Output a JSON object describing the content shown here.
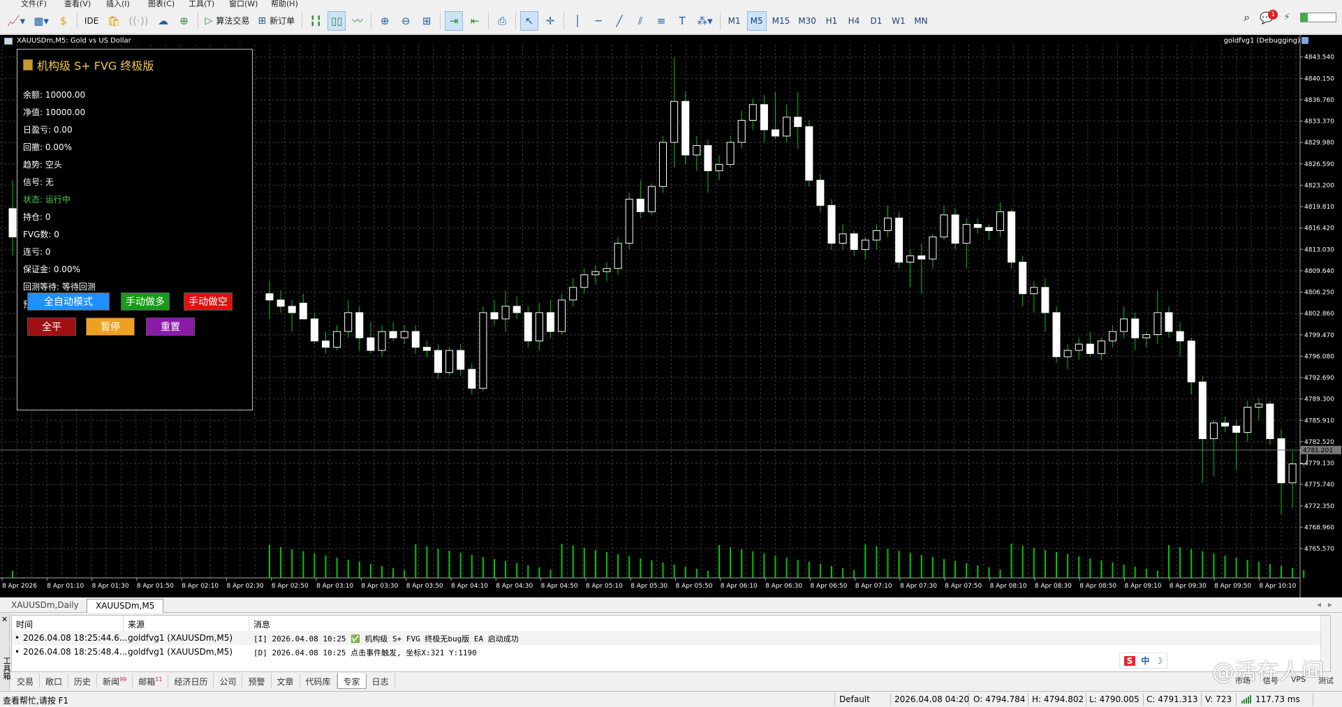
{
  "menu": [
    "文件(F)",
    "查看(V)",
    "插入(I)",
    "图表(C)",
    "工具(T)",
    "窗口(W)",
    "帮助(H)"
  ],
  "toolbar": {
    "ide_label": "IDE",
    "algo_label": "算法交易",
    "new_order_label": "新订单",
    "timeframes": [
      "M1",
      "M5",
      "M15",
      "M30",
      "H1",
      "H4",
      "D1",
      "W1",
      "MN"
    ],
    "active_timeframe": "M5",
    "notification_count": "1"
  },
  "chart": {
    "title": "XAUUSDm,M5:  Gold vs US Dollar",
    "ea_label": "goldfvg1 (Debugging)",
    "current_price_tag": "4781.201",
    "price_ticks": [
      "4843.540",
      "4840.150",
      "4836.760",
      "4833.370",
      "4829.980",
      "4826.590",
      "4823.200",
      "4819.810",
      "4816.420",
      "4813.030",
      "4809.640",
      "4806.250",
      "4802.860",
      "4799.470",
      "4796.080",
      "4792.690",
      "4789.300",
      "4785.910",
      "4782.520",
      "4779.130",
      "4775.740",
      "4772.350",
      "4768.960",
      "4765.570"
    ],
    "time_ticks": [
      "8 Apr 2026",
      "8 Apr 01:10",
      "8 Apr 01:30",
      "8 Apr 01:50",
      "8 Apr 02:10",
      "8 Apr 02:30",
      "8 Apr 02:50",
      "8 Apr 03:10",
      "8 Apr 03:30",
      "8 Apr 03:50",
      "8 Apr 04:10",
      "8 Apr 04:30",
      "8 Apr 04:50",
      "8 Apr 05:10",
      "8 Apr 05:30",
      "8 Apr 05:50",
      "8 Apr 06:10",
      "8 Apr 06:30",
      "8 Apr 06:50",
      "8 Apr 07:10",
      "8 Apr 07:30",
      "8 Apr 07:50",
      "8 Apr 08:10",
      "8 Apr 08:30",
      "8 Apr 08:50",
      "8 Apr 09:10",
      "8 Apr 09:30",
      "8 Apr 09:50",
      "8 Apr 10:10"
    ],
    "colors": {
      "background": "#000000",
      "grid": "#3a3a3a",
      "bull": "#ffffff",
      "bear": "#ffffff",
      "wick": "#00c800",
      "volume": "#00c800"
    }
  },
  "chart_data": {
    "type": "candlestick",
    "symbol": "XAUUSDm",
    "timeframe": "M5",
    "ylim": [
      4763.8,
      4845.5
    ],
    "current_price": 4781.201,
    "candles": [
      {
        "o": 4819.5,
        "h": 4824.0,
        "l": 4812.0,
        "c": 4815.0
      },
      {
        "o": 4806.0,
        "h": 4808.0,
        "l": 4802.0,
        "c": 4805.0
      },
      {
        "o": 4805.0,
        "h": 4806.5,
        "l": 4803.0,
        "c": 4804.0
      },
      {
        "o": 4804.0,
        "h": 4805.0,
        "l": 4800.0,
        "c": 4803.0
      },
      {
        "o": 4804.5,
        "h": 4806.0,
        "l": 4802.0,
        "c": 4802.0
      },
      {
        "o": 4802.0,
        "h": 4803.0,
        "l": 4798.0,
        "c": 4798.5
      },
      {
        "o": 4798.5,
        "h": 4800.0,
        "l": 4796.5,
        "c": 4797.5
      },
      {
        "o": 4797.5,
        "h": 4801.0,
        "l": 4797.0,
        "c": 4800.0
      },
      {
        "o": 4800.0,
        "h": 4805.0,
        "l": 4799.0,
        "c": 4803.0
      },
      {
        "o": 4803.0,
        "h": 4804.0,
        "l": 4797.0,
        "c": 4799.0
      },
      {
        "o": 4799.0,
        "h": 4801.5,
        "l": 4796.5,
        "c": 4797.0
      },
      {
        "o": 4797.0,
        "h": 4801.0,
        "l": 4796.0,
        "c": 4800.0
      },
      {
        "o": 4800.0,
        "h": 4801.5,
        "l": 4798.5,
        "c": 4799.0
      },
      {
        "o": 4799.0,
        "h": 4801.0,
        "l": 4798.0,
        "c": 4800.0
      },
      {
        "o": 4800.0,
        "h": 4801.0,
        "l": 4796.5,
        "c": 4797.5
      },
      {
        "o": 4797.5,
        "h": 4798.5,
        "l": 4796.0,
        "c": 4797.0
      },
      {
        "o": 4797.0,
        "h": 4798.0,
        "l": 4792.5,
        "c": 4793.5
      },
      {
        "o": 4793.5,
        "h": 4797.5,
        "l": 4793.0,
        "c": 4797.0
      },
      {
        "o": 4797.0,
        "h": 4798.0,
        "l": 4793.0,
        "c": 4794.0
      },
      {
        "o": 4794.0,
        "h": 4795.0,
        "l": 4790.0,
        "c": 4791.0
      },
      {
        "o": 4791.0,
        "h": 4804.0,
        "l": 4790.5,
        "c": 4803.0
      },
      {
        "o": 4803.0,
        "h": 4805.0,
        "l": 4801.0,
        "c": 4802.0
      },
      {
        "o": 4802.0,
        "h": 4806.5,
        "l": 4800.0,
        "c": 4804.0
      },
      {
        "o": 4804.0,
        "h": 4805.5,
        "l": 4802.0,
        "c": 4803.0
      },
      {
        "o": 4803.0,
        "h": 4804.0,
        "l": 4797.5,
        "c": 4798.5
      },
      {
        "o": 4798.5,
        "h": 4804.5,
        "l": 4797.0,
        "c": 4803.0
      },
      {
        "o": 4803.0,
        "h": 4805.0,
        "l": 4799.0,
        "c": 4800.0
      },
      {
        "o": 4800.0,
        "h": 4806.0,
        "l": 4799.5,
        "c": 4805.0
      },
      {
        "o": 4805.0,
        "h": 4808.5,
        "l": 4804.0,
        "c": 4807.0
      },
      {
        "o": 4807.0,
        "h": 4810.0,
        "l": 4806.0,
        "c": 4809.0
      },
      {
        "o": 4809.0,
        "h": 4810.5,
        "l": 4807.5,
        "c": 4809.5
      },
      {
        "o": 4809.5,
        "h": 4811.0,
        "l": 4808.0,
        "c": 4810.0
      },
      {
        "o": 4810.0,
        "h": 4815.0,
        "l": 4809.0,
        "c": 4814.0
      },
      {
        "o": 4814.0,
        "h": 4822.0,
        "l": 4813.0,
        "c": 4821.0
      },
      {
        "o": 4821.0,
        "h": 4824.0,
        "l": 4818.0,
        "c": 4819.0
      },
      {
        "o": 4819.0,
        "h": 4823.5,
        "l": 4818.5,
        "c": 4823.0
      },
      {
        "o": 4823.0,
        "h": 4831.0,
        "l": 4822.0,
        "c": 4830.0
      },
      {
        "o": 4830.0,
        "h": 4843.5,
        "l": 4826.0,
        "c": 4836.5
      },
      {
        "o": 4836.5,
        "h": 4838.0,
        "l": 4826.5,
        "c": 4828.0
      },
      {
        "o": 4828.0,
        "h": 4831.0,
        "l": 4825.5,
        "c": 4829.5
      },
      {
        "o": 4829.5,
        "h": 4830.5,
        "l": 4822.0,
        "c": 4825.5
      },
      {
        "o": 4825.5,
        "h": 4828.0,
        "l": 4824.0,
        "c": 4826.5
      },
      {
        "o": 4826.5,
        "h": 4831.0,
        "l": 4826.0,
        "c": 4830.0
      },
      {
        "o": 4830.0,
        "h": 4835.0,
        "l": 4829.0,
        "c": 4833.5
      },
      {
        "o": 4833.5,
        "h": 4837.0,
        "l": 4832.0,
        "c": 4836.0
      },
      {
        "o": 4836.0,
        "h": 4837.5,
        "l": 4830.0,
        "c": 4832.0
      },
      {
        "o": 4832.0,
        "h": 4838.0,
        "l": 4830.5,
        "c": 4831.0
      },
      {
        "o": 4831.0,
        "h": 4836.0,
        "l": 4830.0,
        "c": 4834.0
      },
      {
        "o": 4834.0,
        "h": 4838.0,
        "l": 4829.0,
        "c": 4832.5
      },
      {
        "o": 4832.5,
        "h": 4833.5,
        "l": 4823.0,
        "c": 4824.0
      },
      {
        "o": 4824.0,
        "h": 4825.0,
        "l": 4819.0,
        "c": 4820.0
      },
      {
        "o": 4820.0,
        "h": 4821.0,
        "l": 4813.0,
        "c": 4814.0
      },
      {
        "o": 4814.0,
        "h": 4817.0,
        "l": 4813.0,
        "c": 4815.5
      },
      {
        "o": 4815.5,
        "h": 4816.0,
        "l": 4812.0,
        "c": 4813.0
      },
      {
        "o": 4813.0,
        "h": 4815.0,
        "l": 4811.5,
        "c": 4814.5
      },
      {
        "o": 4814.5,
        "h": 4817.0,
        "l": 4813.0,
        "c": 4816.0
      },
      {
        "o": 4816.0,
        "h": 4820.0,
        "l": 4815.0,
        "c": 4818.0
      },
      {
        "o": 4818.0,
        "h": 4819.0,
        "l": 4810.0,
        "c": 4811.0
      },
      {
        "o": 4811.0,
        "h": 4813.0,
        "l": 4807.0,
        "c": 4812.0
      },
      {
        "o": 4812.0,
        "h": 4814.0,
        "l": 4806.0,
        "c": 4811.5
      },
      {
        "o": 4811.5,
        "h": 4815.5,
        "l": 4810.0,
        "c": 4815.0
      },
      {
        "o": 4815.0,
        "h": 4820.0,
        "l": 4814.5,
        "c": 4818.5
      },
      {
        "o": 4818.5,
        "h": 4819.5,
        "l": 4813.0,
        "c": 4814.0
      },
      {
        "o": 4814.0,
        "h": 4818.0,
        "l": 4810.0,
        "c": 4817.0
      },
      {
        "o": 4817.0,
        "h": 4818.0,
        "l": 4815.5,
        "c": 4816.5
      },
      {
        "o": 4816.5,
        "h": 4817.0,
        "l": 4814.5,
        "c": 4816.0
      },
      {
        "o": 4816.0,
        "h": 4820.5,
        "l": 4815.0,
        "c": 4819.0
      },
      {
        "o": 4819.0,
        "h": 4819.5,
        "l": 4810.0,
        "c": 4811.0
      },
      {
        "o": 4811.0,
        "h": 4812.0,
        "l": 4804.0,
        "c": 4806.0
      },
      {
        "o": 4806.0,
        "h": 4808.0,
        "l": 4803.0,
        "c": 4807.0
      },
      {
        "o": 4807.0,
        "h": 4808.5,
        "l": 4800.0,
        "c": 4803.0
      },
      {
        "o": 4803.0,
        "h": 4804.0,
        "l": 4795.0,
        "c": 4796.0
      },
      {
        "o": 4796.0,
        "h": 4798.0,
        "l": 4794.0,
        "c": 4797.0
      },
      {
        "o": 4797.0,
        "h": 4799.0,
        "l": 4795.5,
        "c": 4798.0
      },
      {
        "o": 4798.0,
        "h": 4800.0,
        "l": 4796.0,
        "c": 4796.5
      },
      {
        "o": 4796.5,
        "h": 4799.0,
        "l": 4795.5,
        "c": 4798.5
      },
      {
        "o": 4798.5,
        "h": 4801.0,
        "l": 4797.5,
        "c": 4800.0
      },
      {
        "o": 4800.0,
        "h": 4804.0,
        "l": 4799.0,
        "c": 4802.0
      },
      {
        "o": 4802.0,
        "h": 4803.0,
        "l": 4797.0,
        "c": 4799.0
      },
      {
        "o": 4799.0,
        "h": 4800.0,
        "l": 4797.5,
        "c": 4799.5
      },
      {
        "o": 4799.5,
        "h": 4806.5,
        "l": 4798.0,
        "c": 4803.0
      },
      {
        "o": 4803.0,
        "h": 4804.0,
        "l": 4799.0,
        "c": 4800.0
      },
      {
        "o": 4800.0,
        "h": 4801.5,
        "l": 4796.0,
        "c": 4798.5
      },
      {
        "o": 4798.5,
        "h": 4799.0,
        "l": 4790.0,
        "c": 4792.0
      },
      {
        "o": 4792.0,
        "h": 4793.0,
        "l": 4776.0,
        "c": 4783.0
      },
      {
        "o": 4783.0,
        "h": 4786.0,
        "l": 4777.0,
        "c": 4785.5
      },
      {
        "o": 4785.5,
        "h": 4786.5,
        "l": 4784.0,
        "c": 4785.0
      },
      {
        "o": 4785.0,
        "h": 4786.0,
        "l": 4778.0,
        "c": 4784.0
      },
      {
        "o": 4784.0,
        "h": 4789.0,
        "l": 4782.5,
        "c": 4788.0
      },
      {
        "o": 4788.0,
        "h": 4789.5,
        "l": 4786.0,
        "c": 4788.5
      },
      {
        "o": 4788.5,
        "h": 4789.0,
        "l": 4782.0,
        "c": 4783.0
      },
      {
        "o": 4783.0,
        "h": 4784.5,
        "l": 4771.0,
        "c": 4776.0
      },
      {
        "o": 4776.0,
        "h": 4781.0,
        "l": 4772.0,
        "c": 4779.0
      },
      {
        "o": 4779.0,
        "h": 4781.5,
        "l": 4778.5,
        "c": 4781.2
      }
    ]
  },
  "ea_panel": {
    "title": "机构级 S+ FVG 终极版",
    "lines": [
      "余额: 10000.00",
      "净值: 10000.00",
      "日盈亏: 0.00",
      "回撤: 0.00%",
      "趋势: 空头",
      "信号: 无",
      "状态: 运行中",
      "持仓: 0",
      "FVG数: 0",
      "连亏: 0",
      "保证金: 0.00%",
      "回测等待: 等待回测",
      "预设: 黄金"
    ],
    "status_line_color": "#43d14a",
    "buttons": [
      {
        "label": "全自动模式",
        "color": "#1e90ff"
      },
      {
        "label": "手动做多",
        "color": "#1a9a1a"
      },
      {
        "label": "手动做空",
        "color": "#e01010"
      },
      {
        "label": "全平",
        "color": "#a01010"
      },
      {
        "label": "暂停",
        "color": "#f0a020"
      },
      {
        "label": "重置",
        "color": "#8a1aa8"
      }
    ]
  },
  "chart_tabs": [
    "XAUUSDm,Daily",
    "XAUUSDm,M5"
  ],
  "chart_tab_active": 1,
  "toolbox": {
    "side_label": "工具箱",
    "columns": [
      "时间",
      "来源",
      "消息"
    ],
    "rows": [
      {
        "time": "2026.04.08 18:25:44.6...",
        "source": "goldfvg1 (XAUUSDm,M5)",
        "message": "[I] 2026.04.08 10:25 ✅ 机构级 S+ FVG 终极无bug版 EA 启动成功"
      },
      {
        "time": "2026.04.08 18:25:48.4...",
        "source": "goldfvg1 (XAUUSDm,M5)",
        "message": "[D] 2026.04.08 10:25 点击事件触发, 坐标X:321 Y:1190"
      }
    ],
    "tabs": [
      {
        "label": "交易"
      },
      {
        "label": "敞口"
      },
      {
        "label": "历史"
      },
      {
        "label": "新闻",
        "badge": "99"
      },
      {
        "label": "邮箱",
        "badge": "11"
      },
      {
        "label": "经济日历"
      },
      {
        "label": "公司"
      },
      {
        "label": "预警"
      },
      {
        "label": "文章"
      },
      {
        "label": "代码库"
      },
      {
        "label": "专家"
      },
      {
        "label": "日志"
      }
    ],
    "active_tab": 10,
    "right_items": [
      "市场",
      "信号",
      "VPS",
      "测试"
    ],
    "watermark": "@活在人间",
    "ime": [
      "S",
      "中",
      "☽"
    ]
  },
  "statusbar": {
    "help": "查看帮忙,请按 F1",
    "profile": "Default",
    "datetime": "2026.04.08 04:20",
    "open": "O: 4794.784",
    "high": "H: 4794.802",
    "low": "L: 4790.005",
    "close": "C: 4791.313",
    "volume": "V: 723",
    "ping": "117.73 ms"
  }
}
